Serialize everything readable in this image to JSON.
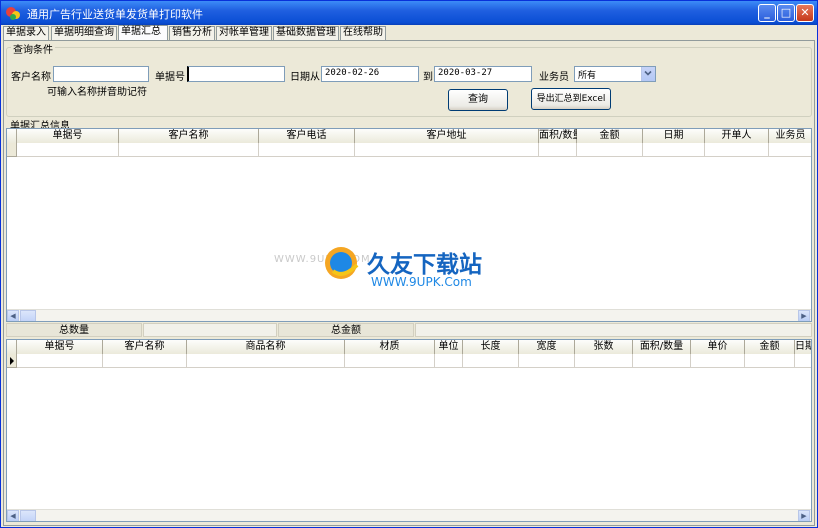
{
  "window": {
    "title": "通用广告行业送货单发货单打印软件"
  },
  "tabs": [
    "单据录入",
    "单据明细查询",
    "单据汇总",
    "销售分析",
    "对帐单管理",
    "基础数据管理",
    "在线帮助"
  ],
  "query": {
    "legend": "查询条件",
    "customer_label": "客户名称",
    "customer_value": "",
    "customer_hint": "可输入名称拼音助记符",
    "doc_no_label": "单据号",
    "doc_no_value": "",
    "date_from_label": "日期从",
    "date_from_value": "2020-02-26",
    "date_to_label": "到",
    "date_to_value": "2020-03-27",
    "salesman_label": "业务员",
    "salesman_value": "所有",
    "query_button": "查询",
    "export_button": "导出汇总到Excel"
  },
  "summary": {
    "legend": "单据汇总信息",
    "columns": [
      "单据号",
      "客户名称",
      "客户电话",
      "客户地址",
      "面积/数量",
      "金额",
      "日期",
      "开单人",
      "业务员"
    ]
  },
  "totals": {
    "count_label": "总数量",
    "amount_label": "总金额"
  },
  "detail": {
    "columns": [
      "单据号",
      "客户名称",
      "商品名称",
      "材质",
      "单位",
      "长度",
      "宽度",
      "张数",
      "面积/数量",
      "单价",
      "金额",
      "日期"
    ]
  },
  "watermark": {
    "brand": "久友下载站",
    "url": "WWW.9UPK.Com",
    "faint": "WWW.9UPK.COM"
  },
  "colors": {
    "title_bar": "#0A4ED4",
    "window_bg": "#ECE9D8",
    "grid_bg": "#FFFFFF"
  }
}
